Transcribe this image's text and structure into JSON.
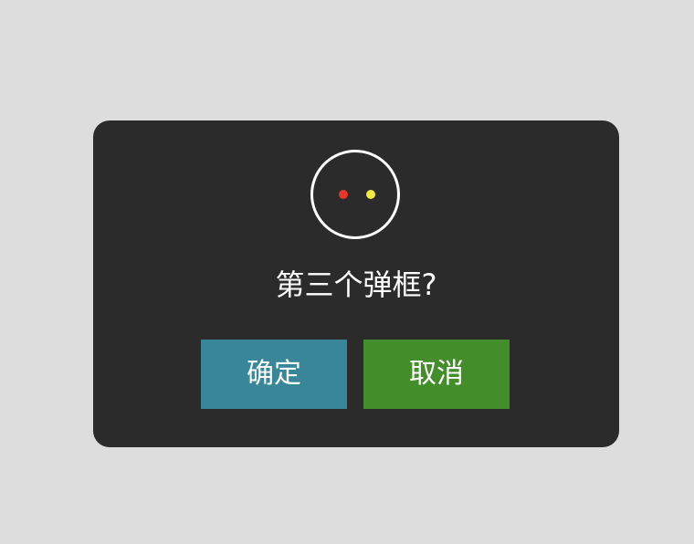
{
  "dialog": {
    "message": "第三个弹框?",
    "confirm_label": "确定",
    "cancel_label": "取消",
    "icon": "face-icon",
    "colors": {
      "backdrop": "#dddddd",
      "dialog_bg": "#2b2b2b",
      "confirm_bg": "#3a8699",
      "cancel_bg": "#438e2a",
      "left_dot": "#e8372a",
      "right_dot": "#f2ea3c"
    }
  }
}
